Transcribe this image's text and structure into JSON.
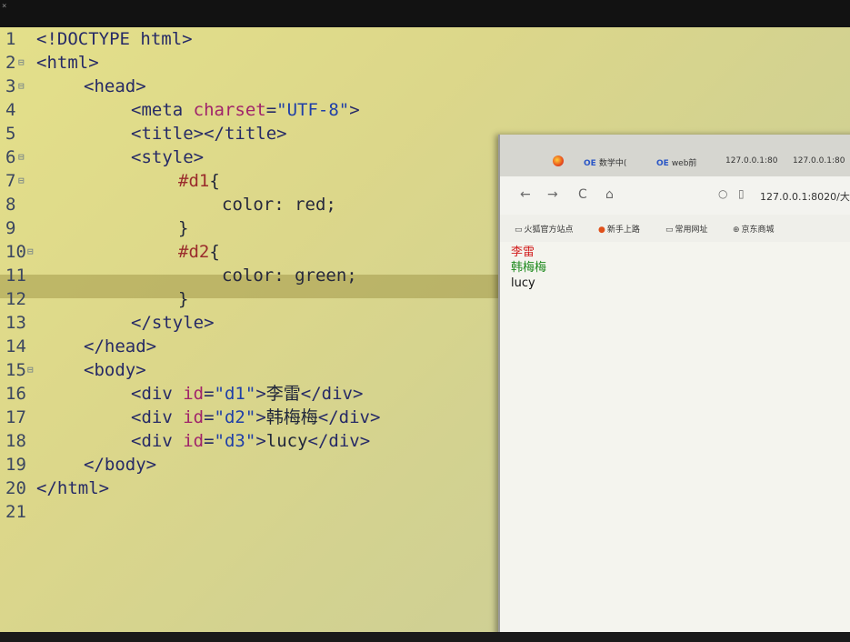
{
  "editor": {
    "lines": [
      {
        "n": "1",
        "fold": "",
        "segs": [
          {
            "c": "tag",
            "t": "<!DOCTYPE html>"
          }
        ],
        "indent": 0
      },
      {
        "n": "2",
        "fold": "⊟",
        "segs": [
          {
            "c": "tag",
            "t": "<html>"
          }
        ],
        "indent": 0
      },
      {
        "n": "3",
        "fold": "⊟",
        "segs": [
          {
            "c": "tag",
            "t": "<head>"
          }
        ],
        "indent": 1
      },
      {
        "n": "4",
        "fold": "",
        "segs": [
          {
            "c": "tag",
            "t": "<meta "
          },
          {
            "c": "attr",
            "t": "charset"
          },
          {
            "c": "tag",
            "t": "="
          },
          {
            "c": "str",
            "t": "\"UTF-8\""
          },
          {
            "c": "tag",
            "t": ">"
          }
        ],
        "indent": 2
      },
      {
        "n": "5",
        "fold": "",
        "segs": [
          {
            "c": "tag",
            "t": "<title></title>"
          }
        ],
        "indent": 2
      },
      {
        "n": "6",
        "fold": "⊟",
        "segs": [
          {
            "c": "tag",
            "t": "<style>"
          }
        ],
        "indent": 2
      },
      {
        "n": "7",
        "fold": "⊟",
        "segs": [
          {
            "c": "sel",
            "t": "#d1"
          },
          {
            "c": "txt",
            "t": "{"
          }
        ],
        "indent": 3
      },
      {
        "n": "8",
        "fold": "",
        "segs": [
          {
            "c": "prop",
            "t": "color: "
          },
          {
            "c": "val",
            "t": "red;"
          }
        ],
        "indent": 4
      },
      {
        "n": "9",
        "fold": "",
        "segs": [
          {
            "c": "txt",
            "t": "}"
          }
        ],
        "indent": 3
      },
      {
        "n": "10",
        "fold": "⊟",
        "segs": [
          {
            "c": "sel",
            "t": "#d2"
          },
          {
            "c": "txt",
            "t": "{"
          }
        ],
        "indent": 3
      },
      {
        "n": "11",
        "fold": "",
        "segs": [
          {
            "c": "prop",
            "t": "color: "
          },
          {
            "c": "val",
            "t": "green;"
          }
        ],
        "indent": 4
      },
      {
        "n": "12",
        "fold": "",
        "segs": [
          {
            "c": "txt",
            "t": "}"
          }
        ],
        "indent": 3
      },
      {
        "n": "13",
        "fold": "",
        "segs": [
          {
            "c": "tag",
            "t": "</style>"
          }
        ],
        "indent": 2
      },
      {
        "n": "14",
        "fold": "",
        "segs": [
          {
            "c": "tag",
            "t": "</head>"
          }
        ],
        "indent": 1
      },
      {
        "n": "15",
        "fold": "⊟",
        "segs": [
          {
            "c": "tag",
            "t": "<body>"
          }
        ],
        "indent": 1
      },
      {
        "n": "16",
        "fold": "",
        "segs": [
          {
            "c": "tag",
            "t": "<div "
          },
          {
            "c": "attr",
            "t": "id"
          },
          {
            "c": "tag",
            "t": "="
          },
          {
            "c": "str",
            "t": "\"d1\""
          },
          {
            "c": "tag",
            "t": ">"
          },
          {
            "c": "txt",
            "t": "李雷"
          },
          {
            "c": "tag",
            "t": "</div>"
          }
        ],
        "indent": 2
      },
      {
        "n": "17",
        "fold": "",
        "segs": [
          {
            "c": "tag",
            "t": "<div "
          },
          {
            "c": "attr",
            "t": "id"
          },
          {
            "c": "tag",
            "t": "="
          },
          {
            "c": "str",
            "t": "\"d2\""
          },
          {
            "c": "tag",
            "t": ">"
          },
          {
            "c": "txt",
            "t": "韩梅梅"
          },
          {
            "c": "tag",
            "t": "</div>"
          }
        ],
        "indent": 2
      },
      {
        "n": "18",
        "fold": "",
        "segs": [
          {
            "c": "tag",
            "t": "<div "
          },
          {
            "c": "attr",
            "t": "id"
          },
          {
            "c": "tag",
            "t": "="
          },
          {
            "c": "str",
            "t": "\"d3\""
          },
          {
            "c": "tag",
            "t": ">"
          },
          {
            "c": "txt",
            "t": "lucy"
          },
          {
            "c": "tag",
            "t": "</div>"
          }
        ],
        "indent": 2
      },
      {
        "n": "19",
        "fold": "",
        "segs": [
          {
            "c": "tag",
            "t": "</body>"
          }
        ],
        "indent": 1
      },
      {
        "n": "20",
        "fold": "",
        "segs": [
          {
            "c": "tag",
            "t": "</html>"
          }
        ],
        "indent": 0
      },
      {
        "n": "21",
        "fold": "",
        "segs": [],
        "indent": 0
      }
    ],
    "highlighted_line": "11"
  },
  "browser": {
    "tabs": [
      {
        "oe": "OE",
        "label": "数学中("
      },
      {
        "oe": "OE",
        "label": "web前"
      },
      {
        "oe": "",
        "label": "127.0.0.1:80"
      },
      {
        "oe": "",
        "label": "127.0.0.1:80"
      }
    ],
    "nav": {
      "back": "←",
      "forward": "→",
      "reload": "C",
      "home": "⌂"
    },
    "url": "127.0.0.1:8020/大",
    "bookmarks": [
      {
        "icon": "folder-icon",
        "label": "火狐官方站点"
      },
      {
        "icon": "firefox-icon",
        "label": "新手上路"
      },
      {
        "icon": "folder-icon",
        "label": "常用网址"
      },
      {
        "icon": "globe-icon",
        "label": "京东商城"
      }
    ],
    "output": [
      {
        "text": "李雷",
        "color": "#d21f1f"
      },
      {
        "text": "韩梅梅",
        "color": "#1f8a1f"
      },
      {
        "text": "lucy",
        "color": "#111111"
      }
    ]
  }
}
